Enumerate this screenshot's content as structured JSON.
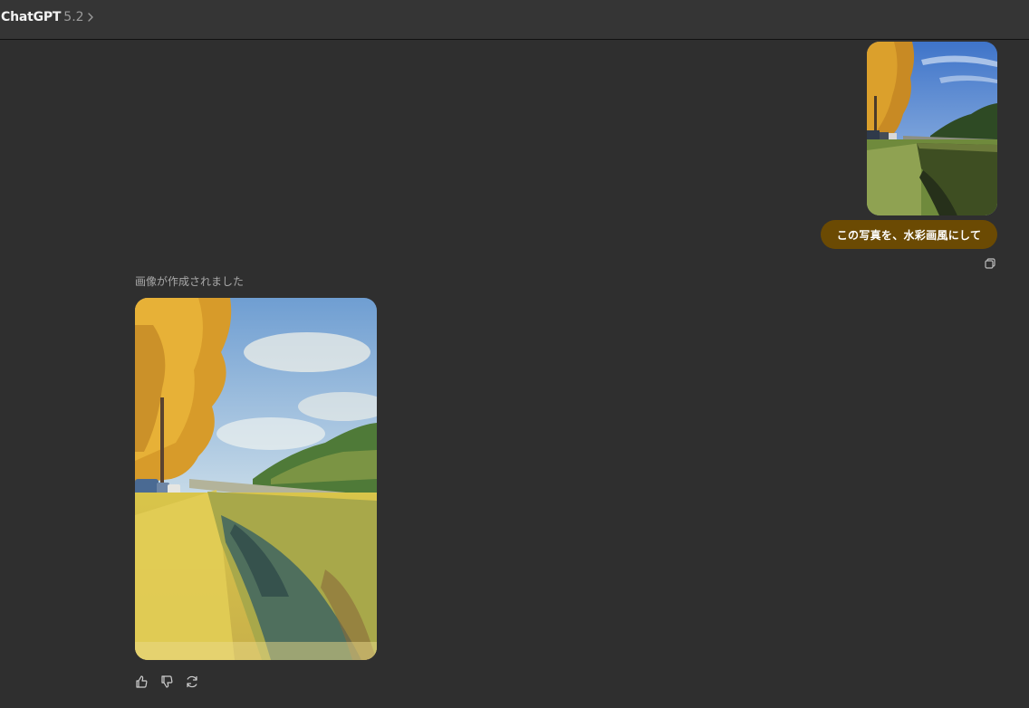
{
  "header": {
    "app_name": "ChatGPT",
    "model_version": "5.2",
    "chevron_icon": "chevron-right-icon"
  },
  "conversation": {
    "user_message": {
      "text": "この写真を、水彩画風にして",
      "bubble_color": "#6b4a03",
      "copy_icon": "copy-icon"
    },
    "assistant_message": {
      "status_text": "画像が作成されました",
      "actions": [
        "thumbs-up-icon",
        "thumbs-down-icon",
        "regenerate-icon"
      ]
    }
  },
  "colors": {
    "background": "#2f2f2f",
    "topbar": "#353535"
  }
}
